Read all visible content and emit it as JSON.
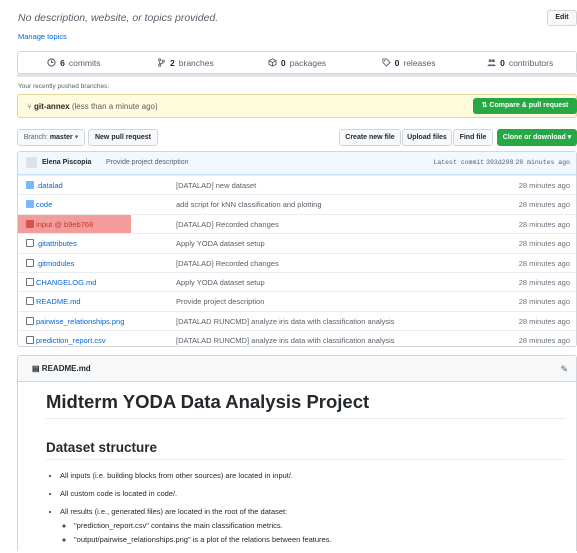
{
  "repo": {
    "description": "No description, website, or topics provided.",
    "manage_topics": "Manage topics",
    "edit": "Edit"
  },
  "stats": {
    "commits_num": "6",
    "commits_label": "commits",
    "branches_num": "2",
    "branches_label": "branches",
    "packages_num": "0",
    "packages_label": "packages",
    "releases_num": "0",
    "releases_label": "releases",
    "contributors_num": "0",
    "contributors_label": "contributors"
  },
  "pushed": {
    "label": "Your recently pushed branches:",
    "branch": "git-annex",
    "time": "(less than a minute ago)",
    "compare": "Compare & pull request"
  },
  "toolbar": {
    "branch_prefix": "Branch:",
    "branch": "master",
    "new_pr": "New pull request",
    "create": "Create new file",
    "upload": "Upload files",
    "find": "Find file",
    "clone": "Clone or download"
  },
  "latest_commit": {
    "author": "Elena Piscopia",
    "message": "Provide project description",
    "prefix": "Latest commit",
    "sha": "393d298",
    "time": "28 minutes ago"
  },
  "files": [
    {
      "name": ".datalad",
      "type": "folder",
      "message": "[DATALAD] new dataset",
      "age": "28 minutes ago"
    },
    {
      "name": "code",
      "type": "folder",
      "message": "add script for kNN classification and plotting",
      "age": "28 minutes ago"
    },
    {
      "name": "input @ b9eb768",
      "type": "submodule",
      "message": "[DATALAD] Recorded changes",
      "age": "28 minutes ago"
    },
    {
      "name": ".gitattributes",
      "type": "file",
      "message": "Apply YODA dataset setup",
      "age": "28 minutes ago"
    },
    {
      "name": ".gitmodules",
      "type": "file",
      "message": "[DATALAD] Recorded changes",
      "age": "28 minutes ago"
    },
    {
      "name": "CHANGELOG.md",
      "type": "file",
      "message": "Apply YODA dataset setup",
      "age": "28 minutes ago"
    },
    {
      "name": "README.md",
      "type": "file",
      "message": "Provide project description",
      "age": "28 minutes ago"
    },
    {
      "name": "pairwise_relationships.png",
      "type": "file",
      "message": "[DATALAD RUNCMD] analyze iris data with classification analysis",
      "age": "28 minutes ago"
    },
    {
      "name": "prediction_report.csv",
      "type": "file",
      "message": "[DATALAD RUNCMD] analyze iris data with classification analysis",
      "age": "28 minutes ago"
    }
  ],
  "readme": {
    "file": "README.md",
    "h1": "Midterm YODA Data Analysis Project",
    "h2": "Dataset structure",
    "bullets": [
      "All inputs (i.e. building blocks from other sources) are located in input/.",
      "All custom code is located in code/.",
      "All results (i.e., generated files) are located in the root of the dataset:"
    ],
    "sub_bullets": [
      "\"prediction_report.csv\" contains the main classification metrics.",
      "\"output/pairwise_relationships.png\" is a plot of the relations between features."
    ]
  }
}
